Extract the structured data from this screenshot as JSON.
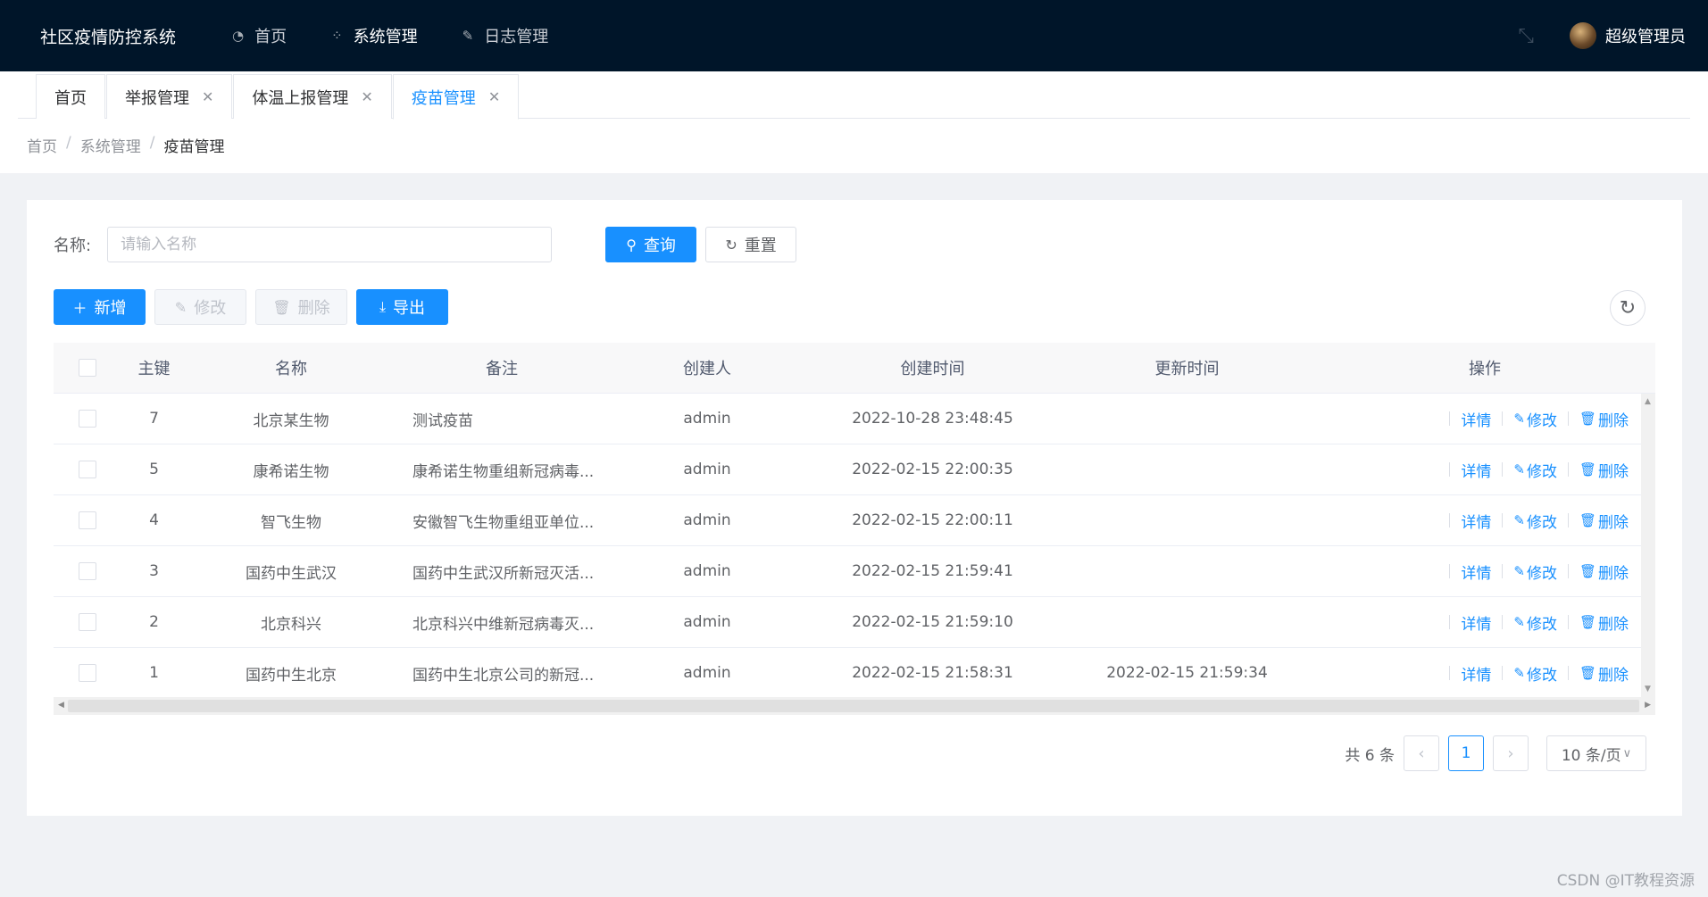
{
  "app": {
    "title": "社区疫情防控系统",
    "nav": [
      {
        "label": "首页",
        "icon": "dashboard-icon",
        "active": false
      },
      {
        "label": "系统管理",
        "icon": "apps-icon",
        "active": true
      },
      {
        "label": "日志管理",
        "icon": "edit-log-icon",
        "active": false
      }
    ],
    "user": "超级管理员"
  },
  "tabs": [
    {
      "label": "首页",
      "closable": false,
      "active": false
    },
    {
      "label": "举报管理",
      "closable": true,
      "active": false
    },
    {
      "label": "体温上报管理",
      "closable": true,
      "active": false
    },
    {
      "label": "疫苗管理",
      "closable": true,
      "active": true
    }
  ],
  "breadcrumb": [
    "首页",
    "系统管理",
    "疫苗管理"
  ],
  "search": {
    "label": "名称:",
    "placeholder": "请输入名称",
    "value": "",
    "query_label": "查询",
    "reset_label": "重置"
  },
  "toolbar": {
    "add_label": "新增",
    "edit_label": "修改",
    "delete_label": "删除",
    "export_label": "导出"
  },
  "table": {
    "columns": [
      "主键",
      "名称",
      "备注",
      "创建人",
      "创建时间",
      "更新时间",
      "操作"
    ],
    "rows": [
      {
        "id": "7",
        "name": "北京某生物",
        "remark": "测试疫苗",
        "creator": "admin",
        "created": "2022-10-28 23:48:45",
        "updated": ""
      },
      {
        "id": "5",
        "name": "康希诺生物",
        "remark": "康希诺生物重组新冠病毒...",
        "creator": "admin",
        "created": "2022-02-15 22:00:35",
        "updated": ""
      },
      {
        "id": "4",
        "name": "智飞生物",
        "remark": "安徽智飞生物重组亚单位...",
        "creator": "admin",
        "created": "2022-02-15 22:00:11",
        "updated": ""
      },
      {
        "id": "3",
        "name": "国药中生武汉",
        "remark": "国药中生武汉所新冠灭活...",
        "creator": "admin",
        "created": "2022-02-15 21:59:41",
        "updated": ""
      },
      {
        "id": "2",
        "name": "北京科兴",
        "remark": "北京科兴中维新冠病毒灭...",
        "creator": "admin",
        "created": "2022-02-15 21:59:10",
        "updated": ""
      },
      {
        "id": "1",
        "name": "国药中生北京",
        "remark": "国药中生北京公司的新冠...",
        "creator": "admin",
        "created": "2022-02-15 21:58:31",
        "updated": "2022-02-15 21:59:34"
      }
    ],
    "row_actions": {
      "detail": "详情",
      "edit": "修改",
      "delete": "删除"
    }
  },
  "pagination": {
    "total_text": "共 6 条",
    "current_page": "1",
    "page_size": "10 条/页"
  },
  "watermark": "CSDN @IT教程资源",
  "colors": {
    "nav_bg": "#001529",
    "primary": "#1890ff"
  }
}
